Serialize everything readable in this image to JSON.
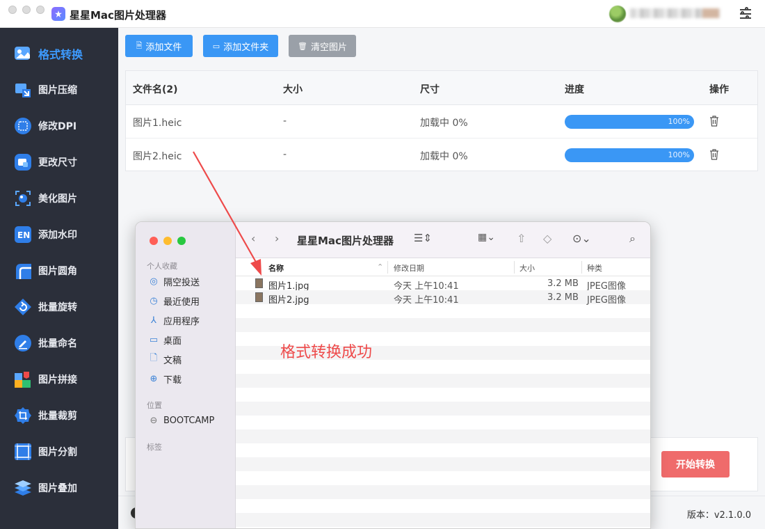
{
  "window": {
    "title": "星星Mac图片处理器"
  },
  "sidebar": {
    "items": [
      {
        "label": "格式转换",
        "icon": "image-convert-icon",
        "active": true
      },
      {
        "label": "图片压缩",
        "icon": "compress-icon"
      },
      {
        "label": "修改DPI",
        "icon": "dpi-icon"
      },
      {
        "label": "更改尺寸",
        "icon": "resize-icon"
      },
      {
        "label": "美化图片",
        "icon": "beautify-icon"
      },
      {
        "label": "添加水印",
        "icon": "watermark-icon"
      },
      {
        "label": "图片圆角",
        "icon": "round-corner-icon"
      },
      {
        "label": "批量旋转",
        "icon": "rotate-icon"
      },
      {
        "label": "批量命名",
        "icon": "rename-icon"
      },
      {
        "label": "图片拼接",
        "icon": "puzzle-icon"
      },
      {
        "label": "批量裁剪",
        "icon": "crop-icon"
      },
      {
        "label": "图片分割",
        "icon": "split-icon"
      },
      {
        "label": "图片叠加",
        "icon": "layers-icon"
      }
    ]
  },
  "toolbar": {
    "add_file": "添加文件",
    "add_folder": "添加文件夹",
    "clear": "清空图片"
  },
  "table": {
    "headers": [
      "文件名(2)",
      "大小",
      "尺寸",
      "进度",
      "操作"
    ],
    "rows": [
      {
        "name": "图片1.heic",
        "size": "-",
        "dimension": "加载中 0%",
        "progress": 100,
        "progress_label": "100%"
      },
      {
        "name": "图片2.heic",
        "size": "-",
        "dimension": "加载中 0%",
        "progress": 100,
        "progress_label": "100%"
      }
    ]
  },
  "actions": {
    "start": "开始转换"
  },
  "status": {
    "version": "版本：v2.1.0.0"
  },
  "finder": {
    "title": "星星Mac图片处理器",
    "sidebar": {
      "favorites_label": "个人收藏",
      "favorites": [
        {
          "label": "隔空投送",
          "icon": "airdrop-icon"
        },
        {
          "label": "最近使用",
          "icon": "clock-icon"
        },
        {
          "label": "应用程序",
          "icon": "apps-icon"
        },
        {
          "label": "桌面",
          "icon": "desktop-icon"
        },
        {
          "label": "文稿",
          "icon": "document-icon"
        },
        {
          "label": "下载",
          "icon": "download-icon"
        }
      ],
      "locations_label": "位置",
      "locations": [
        {
          "label": "BOOTCAMP",
          "icon": "disk-icon"
        }
      ],
      "tags_label": "标签"
    },
    "columns": [
      "名称",
      "修改日期",
      "大小",
      "种类"
    ],
    "files": [
      {
        "name": "图片1.jpg",
        "modified": "今天 上午10:41",
        "size": "3.2 MB",
        "kind": "JPEG图像"
      },
      {
        "name": "图片2.jpg",
        "modified": "今天 上午10:41",
        "size": "3.2 MB",
        "kind": "JPEG图像"
      }
    ]
  },
  "annotation": {
    "text": "格式转换成功",
    "color": "#ee4a4a"
  },
  "colors": {
    "accent": "#3a97f5",
    "sidebar_bg": "#2b2f3a",
    "start_button": "#ef6b6b"
  }
}
